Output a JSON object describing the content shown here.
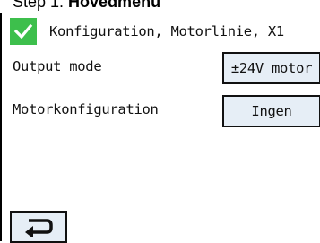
{
  "caption": {
    "prefix": "Step 1: ",
    "title": "Hovedmenu"
  },
  "header": {
    "title": "Konfiguration, Motorlinie, X1",
    "status_icon": "checkmark-icon",
    "status_color": "#3dbf4c"
  },
  "rows": [
    {
      "label": "Output mode",
      "value": "±24V motor"
    },
    {
      "label": "Motorkonfiguration",
      "value": "Ingen"
    }
  ],
  "footer": {
    "back_icon": "return-arrow-icon"
  }
}
